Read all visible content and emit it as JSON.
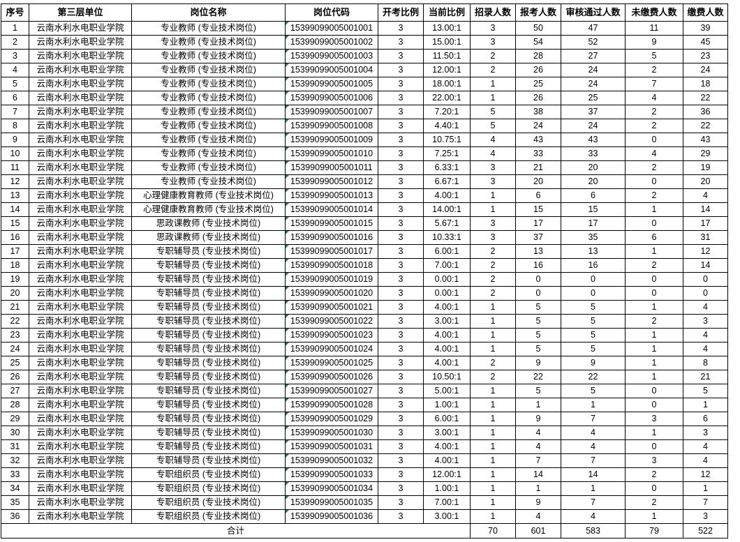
{
  "headers": [
    "序号",
    "第三层单位",
    "岗位名称",
    "岗位代码",
    "开考比例",
    "当前比例",
    "招录人数",
    "报考人数",
    "审核通过人数",
    "未缴费人数",
    "缴费人数"
  ],
  "rows": [
    [
      "1",
      "云南水利水电职业学院",
      "专业教师 (专业技术岗位)",
      "15399099005001001",
      "3",
      "13.00:1",
      "3",
      "50",
      "47",
      "11",
      "39"
    ],
    [
      "2",
      "云南水利水电职业学院",
      "专业教师 (专业技术岗位)",
      "15399099005001002",
      "3",
      "15.00:1",
      "3",
      "54",
      "52",
      "9",
      "45"
    ],
    [
      "3",
      "云南水利水电职业学院",
      "专业教师 (专业技术岗位)",
      "15399099005001003",
      "3",
      "11.50:1",
      "2",
      "28",
      "27",
      "5",
      "23"
    ],
    [
      "4",
      "云南水利水电职业学院",
      "专业教师 (专业技术岗位)",
      "15399099005001004",
      "3",
      "12.00:1",
      "2",
      "26",
      "24",
      "2",
      "24"
    ],
    [
      "5",
      "云南水利水电职业学院",
      "专业教师 (专业技术岗位)",
      "15399099005001005",
      "3",
      "18.00:1",
      "1",
      "25",
      "24",
      "7",
      "18"
    ],
    [
      "6",
      "云南水利水电职业学院",
      "专业教师 (专业技术岗位)",
      "15399099005001006",
      "3",
      "22.00:1",
      "1",
      "26",
      "25",
      "4",
      "22"
    ],
    [
      "7",
      "云南水利水电职业学院",
      "专业教师 (专业技术岗位)",
      "15399099005001007",
      "3",
      "7.20:1",
      "5",
      "38",
      "37",
      "2",
      "36"
    ],
    [
      "8",
      "云南水利水电职业学院",
      "专业教师 (专业技术岗位)",
      "15399099005001008",
      "3",
      "4.40:1",
      "5",
      "24",
      "24",
      "2",
      "22"
    ],
    [
      "9",
      "云南水利水电职业学院",
      "专业教师 (专业技术岗位)",
      "15399099005001009",
      "3",
      "10.75:1",
      "4",
      "43",
      "43",
      "0",
      "43"
    ],
    [
      "10",
      "云南水利水电职业学院",
      "专业教师 (专业技术岗位)",
      "15399099005001010",
      "3",
      "7.25:1",
      "4",
      "33",
      "33",
      "4",
      "29"
    ],
    [
      "11",
      "云南水利水电职业学院",
      "专业教师 (专业技术岗位)",
      "15399099005001011",
      "3",
      "6.33:1",
      "3",
      "21",
      "20",
      "2",
      "19"
    ],
    [
      "12",
      "云南水利水电职业学院",
      "专业教师 (专业技术岗位)",
      "15399099005001012",
      "3",
      "6.67:1",
      "3",
      "20",
      "20",
      "0",
      "20"
    ],
    [
      "13",
      "云南水利水电职业学院",
      "心理健康教育教师 (专业技术岗位)",
      "15399099005001013",
      "3",
      "4.00:1",
      "1",
      "6",
      "6",
      "2",
      "4"
    ],
    [
      "14",
      "云南水利水电职业学院",
      "心理健康教育教师 (专业技术岗位)",
      "15399099005001014",
      "3",
      "14.00:1",
      "1",
      "15",
      "15",
      "1",
      "14"
    ],
    [
      "15",
      "云南水利水电职业学院",
      "思政课教师 (专业技术岗位)",
      "15399099005001015",
      "3",
      "5.67:1",
      "3",
      "17",
      "17",
      "0",
      "17"
    ],
    [
      "16",
      "云南水利水电职业学院",
      "思政课教师 (专业技术岗位)",
      "15399099005001016",
      "3",
      "10.33:1",
      "3",
      "37",
      "35",
      "6",
      "31"
    ],
    [
      "17",
      "云南水利水电职业学院",
      "专职辅导员 (专业技术岗位)",
      "15399099005001017",
      "3",
      "6.00:1",
      "2",
      "13",
      "13",
      "1",
      "12"
    ],
    [
      "18",
      "云南水利水电职业学院",
      "专职辅导员 (专业技术岗位)",
      "15399099005001018",
      "3",
      "7.00:1",
      "2",
      "16",
      "16",
      "2",
      "14"
    ],
    [
      "19",
      "云南水利水电职业学院",
      "专职辅导员 (专业技术岗位)",
      "15399099005001019",
      "3",
      "0.00:1",
      "2",
      "0",
      "0",
      "0",
      "0"
    ],
    [
      "20",
      "云南水利水电职业学院",
      "专职辅导员 (专业技术岗位)",
      "15399099005001020",
      "3",
      "0.00:1",
      "2",
      "0",
      "0",
      "0",
      "0"
    ],
    [
      "21",
      "云南水利水电职业学院",
      "专职辅导员 (专业技术岗位)",
      "15399099005001021",
      "3",
      "4.00:1",
      "1",
      "5",
      "5",
      "1",
      "4"
    ],
    [
      "22",
      "云南水利水电职业学院",
      "专职辅导员 (专业技术岗位)",
      "15399099005001022",
      "3",
      "3.00:1",
      "1",
      "5",
      "5",
      "2",
      "3"
    ],
    [
      "23",
      "云南水利水电职业学院",
      "专职辅导员 (专业技术岗位)",
      "15399099005001023",
      "3",
      "4.00:1",
      "1",
      "5",
      "5",
      "1",
      "4"
    ],
    [
      "24",
      "云南水利水电职业学院",
      "专职辅导员 (专业技术岗位)",
      "15399099005001024",
      "3",
      "4.00:1",
      "1",
      "5",
      "5",
      "1",
      "4"
    ],
    [
      "25",
      "云南水利水电职业学院",
      "专职辅导员 (专业技术岗位)",
      "15399099005001025",
      "3",
      "4.00:1",
      "2",
      "9",
      "9",
      "1",
      "8"
    ],
    [
      "26",
      "云南水利水电职业学院",
      "专职辅导员 (专业技术岗位)",
      "15399099005001026",
      "3",
      "10.50:1",
      "2",
      "22",
      "22",
      "1",
      "21"
    ],
    [
      "27",
      "云南水利水电职业学院",
      "专职辅导员 (专业技术岗位)",
      "15399099005001027",
      "3",
      "5.00:1",
      "1",
      "5",
      "5",
      "0",
      "5"
    ],
    [
      "28",
      "云南水利水电职业学院",
      "专职辅导员 (专业技术岗位)",
      "15399099005001028",
      "3",
      "1.00:1",
      "1",
      "1",
      "1",
      "0",
      "1"
    ],
    [
      "29",
      "云南水利水电职业学院",
      "专职辅导员 (专业技术岗位)",
      "15399099005001029",
      "3",
      "6.00:1",
      "1",
      "9",
      "7",
      "3",
      "6"
    ],
    [
      "30",
      "云南水利水电职业学院",
      "专职辅导员 (专业技术岗位)",
      "15399099005001030",
      "3",
      "3.00:1",
      "1",
      "4",
      "4",
      "1",
      "3"
    ],
    [
      "31",
      "云南水利水电职业学院",
      "专职辅导员 (专业技术岗位)",
      "15399099005001031",
      "3",
      "4.00:1",
      "1",
      "4",
      "4",
      "0",
      "4"
    ],
    [
      "32",
      "云南水利水电职业学院",
      "专职辅导员 (专业技术岗位)",
      "15399099005001032",
      "3",
      "4.00:1",
      "1",
      "7",
      "7",
      "3",
      "4"
    ],
    [
      "33",
      "云南水利水电职业学院",
      "专职组织员 (专业技术岗位)",
      "15399099005001033",
      "3",
      "12.00:1",
      "1",
      "14",
      "14",
      "2",
      "12"
    ],
    [
      "34",
      "云南水利水电职业学院",
      "专职组织员 (专业技术岗位)",
      "15399099005001034",
      "3",
      "1.00:1",
      "1",
      "1",
      "1",
      "0",
      "1"
    ],
    [
      "35",
      "云南水利水电职业学院",
      "专职组织员 (专业技术岗位)",
      "15399099005001035",
      "3",
      "7.00:1",
      "1",
      "9",
      "7",
      "2",
      "7"
    ],
    [
      "36",
      "云南水利水电职业学院",
      "专职组织员 (专业技术岗位)",
      "15399099005001036",
      "3",
      "3.00:1",
      "1",
      "4",
      "4",
      "1",
      "3"
    ]
  ],
  "total": {
    "label": "合计",
    "recruit": "70",
    "applied": "601",
    "approved": "583",
    "unpaid": "79",
    "paid": "522"
  }
}
